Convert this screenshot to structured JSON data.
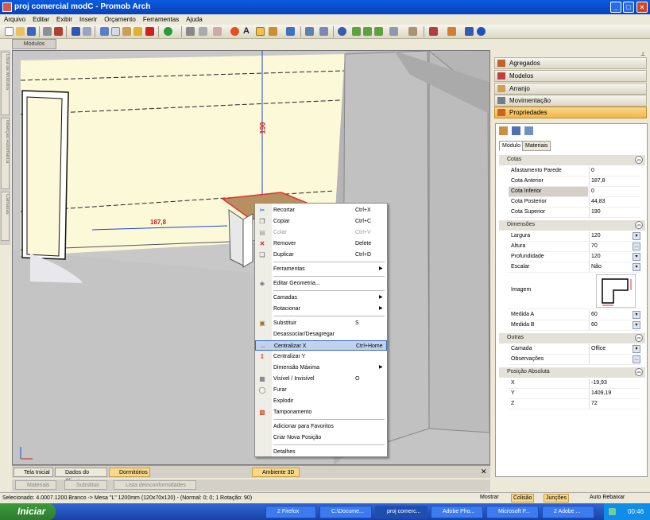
{
  "window": {
    "title": "proj comercial modC - Promob Arch",
    "controls": [
      "_",
      "□",
      "×"
    ]
  },
  "menu": [
    "Arquivo",
    "Editar",
    "Exibir",
    "Inserir",
    "Orçamento",
    "Ferramentas",
    "Ajuda"
  ],
  "module_tab": "Módulos",
  "left_vtabs": [
    "Lista de Módulos",
    "Inserção Automática",
    "Camadas"
  ],
  "viewport": {
    "dimension_vertical": "190",
    "dimension_horizontal": "187,8"
  },
  "context_menu": {
    "items": [
      {
        "label": "Recortar",
        "shortcut": "Ctrl+X",
        "icon": "scissors-icon"
      },
      {
        "label": "Copiar",
        "shortcut": "Ctrl+C",
        "icon": "copy-icon"
      },
      {
        "label": "Colar",
        "shortcut": "Ctrl+V",
        "icon": "paste-icon",
        "disabled": true
      },
      {
        "label": "Remover",
        "shortcut": "Delete",
        "icon": "delete-icon"
      },
      {
        "label": "Duplicar",
        "shortcut": "Ctrl+D",
        "icon": "duplicate-icon"
      },
      {
        "label": "Ferramentas",
        "submenu": true
      },
      {
        "label": "Editar Geometria...",
        "icon": "geometry-icon"
      },
      {
        "label": "Camadas",
        "submenu": true
      },
      {
        "label": "Rotacionar",
        "submenu": true
      },
      {
        "label": "Substituir",
        "shortcut": "S",
        "icon": "replace-icon"
      },
      {
        "label": "Desassociar/Desagregar"
      },
      {
        "label": "Centralizar X",
        "shortcut": "Ctrl+Home",
        "icon": "center-x-icon",
        "highlighted": true
      },
      {
        "label": "Centralizar Y",
        "icon": "center-y-icon"
      },
      {
        "label": "Dimensão Máxima",
        "submenu": true
      },
      {
        "label": "Visível / Invisível",
        "shortcut": "O",
        "icon": "visibility-icon"
      },
      {
        "label": "Furar",
        "icon": "drill-icon"
      },
      {
        "label": "Explodir"
      },
      {
        "label": "Tamponamento",
        "icon": "cover-icon"
      },
      {
        "label": "Adicionar para Favoritos"
      },
      {
        "label": "Criar Nova Posição"
      },
      {
        "label": "Detalhes"
      }
    ]
  },
  "bottom_tabs": [
    "Tela Inicial",
    "Dados do Cliente",
    "Dormitórios",
    "Ambiente 3D"
  ],
  "secondary_tabs": [
    "Materiais",
    "Substituir",
    "Lista deinconformidades"
  ],
  "status": {
    "text": "Selecionado: 4.0007.1200.Branco -> Mesa \"L\" 1200mm (120x70x120) - (Normal: 0; 0; 1 Rotação: 90)",
    "right_items": [
      "Mostrar",
      "Colisão",
      "Junções",
      "Auto Rebaixar"
    ]
  },
  "taskbar": {
    "start": "Iniciar",
    "tasks": [
      "2 Firefox",
      "C:\\Docume...",
      "proj comerc...",
      "Adobe Pho...",
      "Microsoft P...",
      "2 Adobe ..."
    ],
    "clock": "00:46"
  },
  "right_panel": {
    "items": [
      "Agregados",
      "Modelos",
      "Arranjo",
      "Movimentação",
      "Propriedades"
    ],
    "selected": "Propriedades",
    "prop_tabs": [
      "Módulo",
      "Materiais"
    ],
    "sections": [
      {
        "title": "Cotas",
        "rows": [
          {
            "k": "Afastamento Parede",
            "v": "0"
          },
          {
            "k": "Cota Anterior",
            "v": "187,8"
          },
          {
            "k": "Cota Inferior",
            "v": "0"
          },
          {
            "k": "Cota Posterior",
            "v": "44,83"
          },
          {
            "k": "Cota Superior",
            "v": "190"
          }
        ]
      },
      {
        "title": "Dimensões",
        "rows": [
          {
            "k": "Largura",
            "v": "120"
          },
          {
            "k": "Altura",
            "v": "70"
          },
          {
            "k": "Profundidade",
            "v": "120"
          },
          {
            "k": "Escalar",
            "v": "Não"
          },
          {
            "k": "Imagem",
            "v": ""
          },
          {
            "k": "Medida A",
            "v": "60"
          },
          {
            "k": "Medida B",
            "v": "60"
          }
        ]
      },
      {
        "title": "Outras",
        "rows": [
          {
            "k": "Camada",
            "v": "Office"
          },
          {
            "k": "Observações",
            "v": ""
          }
        ]
      },
      {
        "title": "Posição Absoluta",
        "rows": [
          {
            "k": "X",
            "v": "-19,93"
          },
          {
            "k": "Y",
            "v": "1409,19"
          },
          {
            "k": "Z",
            "v": "72"
          }
        ]
      }
    ]
  }
}
